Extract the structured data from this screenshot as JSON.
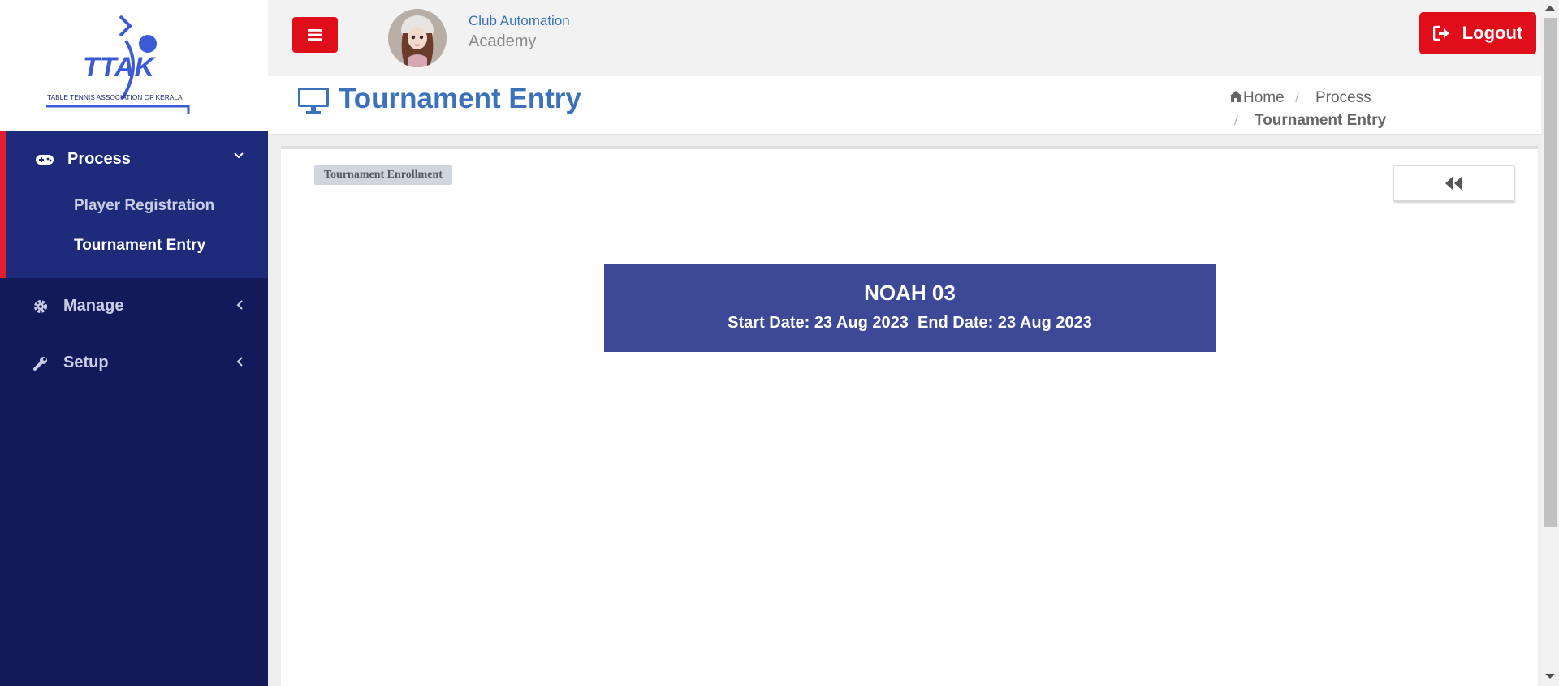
{
  "sidebar": {
    "logo": {
      "text": "TTAK",
      "subtitle": "TABLE TENNIS ASSOCIATION OF KERALA"
    },
    "menu": [
      {
        "label": "Process",
        "icon": "gamepad-icon",
        "expanded": true,
        "items": [
          {
            "label": "Player Registration",
            "active": false
          },
          {
            "label": "Tournament Entry",
            "active": true
          }
        ]
      },
      {
        "label": "Manage",
        "icon": "gear-icon",
        "expanded": false
      },
      {
        "label": "Setup",
        "icon": "wrench-icon",
        "expanded": false
      }
    ]
  },
  "header": {
    "club_name": "Club Automation",
    "club_sub": "Academy",
    "logout_label": "Logout"
  },
  "page": {
    "title": "Tournament Entry",
    "title_icon": "desktop-icon",
    "breadcrumb": [
      "Home",
      "Process",
      "Tournament Entry"
    ]
  },
  "content": {
    "badge": "Tournament Enrollment",
    "back_icon": "double-left-icon",
    "tournament": {
      "name": "NOAH 03",
      "dates": "Start Date: 23 Aug 2023  End Date: 23 Aug 2023"
    }
  },
  "colors": {
    "sidebar_bg": "#121a5a",
    "sidebar_active_bg": "#1e2a7a",
    "accent_red": "#e00d1b",
    "title_blue": "#3b72b9",
    "card_bg": "#3d4997"
  }
}
